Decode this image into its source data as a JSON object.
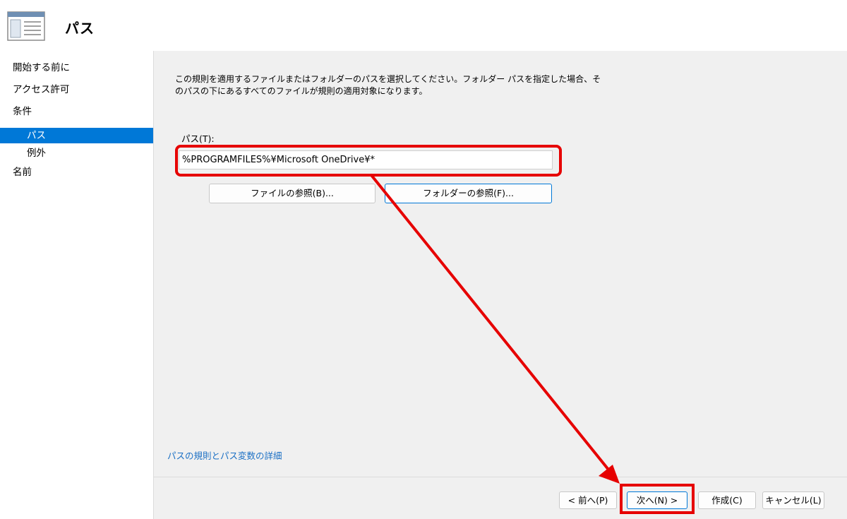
{
  "header": {
    "title": "パス",
    "icon": "window-list-icon"
  },
  "nav": {
    "items": [
      {
        "label": "開始する前に",
        "level": 0,
        "selected": false
      },
      {
        "label": "アクセス許可",
        "level": 0,
        "selected": false
      },
      {
        "label": "条件",
        "level": 0,
        "selected": false
      },
      {
        "label": "パス",
        "level": 1,
        "selected": true
      },
      {
        "label": "例外",
        "level": 1,
        "selected": false
      },
      {
        "label": "名前",
        "level": 0,
        "selected": false
      }
    ]
  },
  "main": {
    "description_line1": "この規則を適用するファイルまたはフォルダーのパスを選択してください。フォルダー パスを指定した場合、そ",
    "description_line2": "のパスの下にあるすべてのファイルが規則の適用対象になります。",
    "path_label": "パス(T):",
    "path_value": "%PROGRAMFILES%¥Microsoft OneDrive¥*",
    "browse_file_label": "ファイルの参照(B)...",
    "browse_folder_label": "フォルダーの参照(F)...",
    "detail_link": "パスの規則とパス変数の詳細"
  },
  "footer": {
    "prev_label": "< 前へ(P)",
    "next_label": "次へ(N) >",
    "create_label": "作成(C)",
    "cancel_label": "キャンセル(L)"
  },
  "colors": {
    "accent": "#0078d7",
    "highlight": "#e60000",
    "link": "#1a6fc4"
  }
}
